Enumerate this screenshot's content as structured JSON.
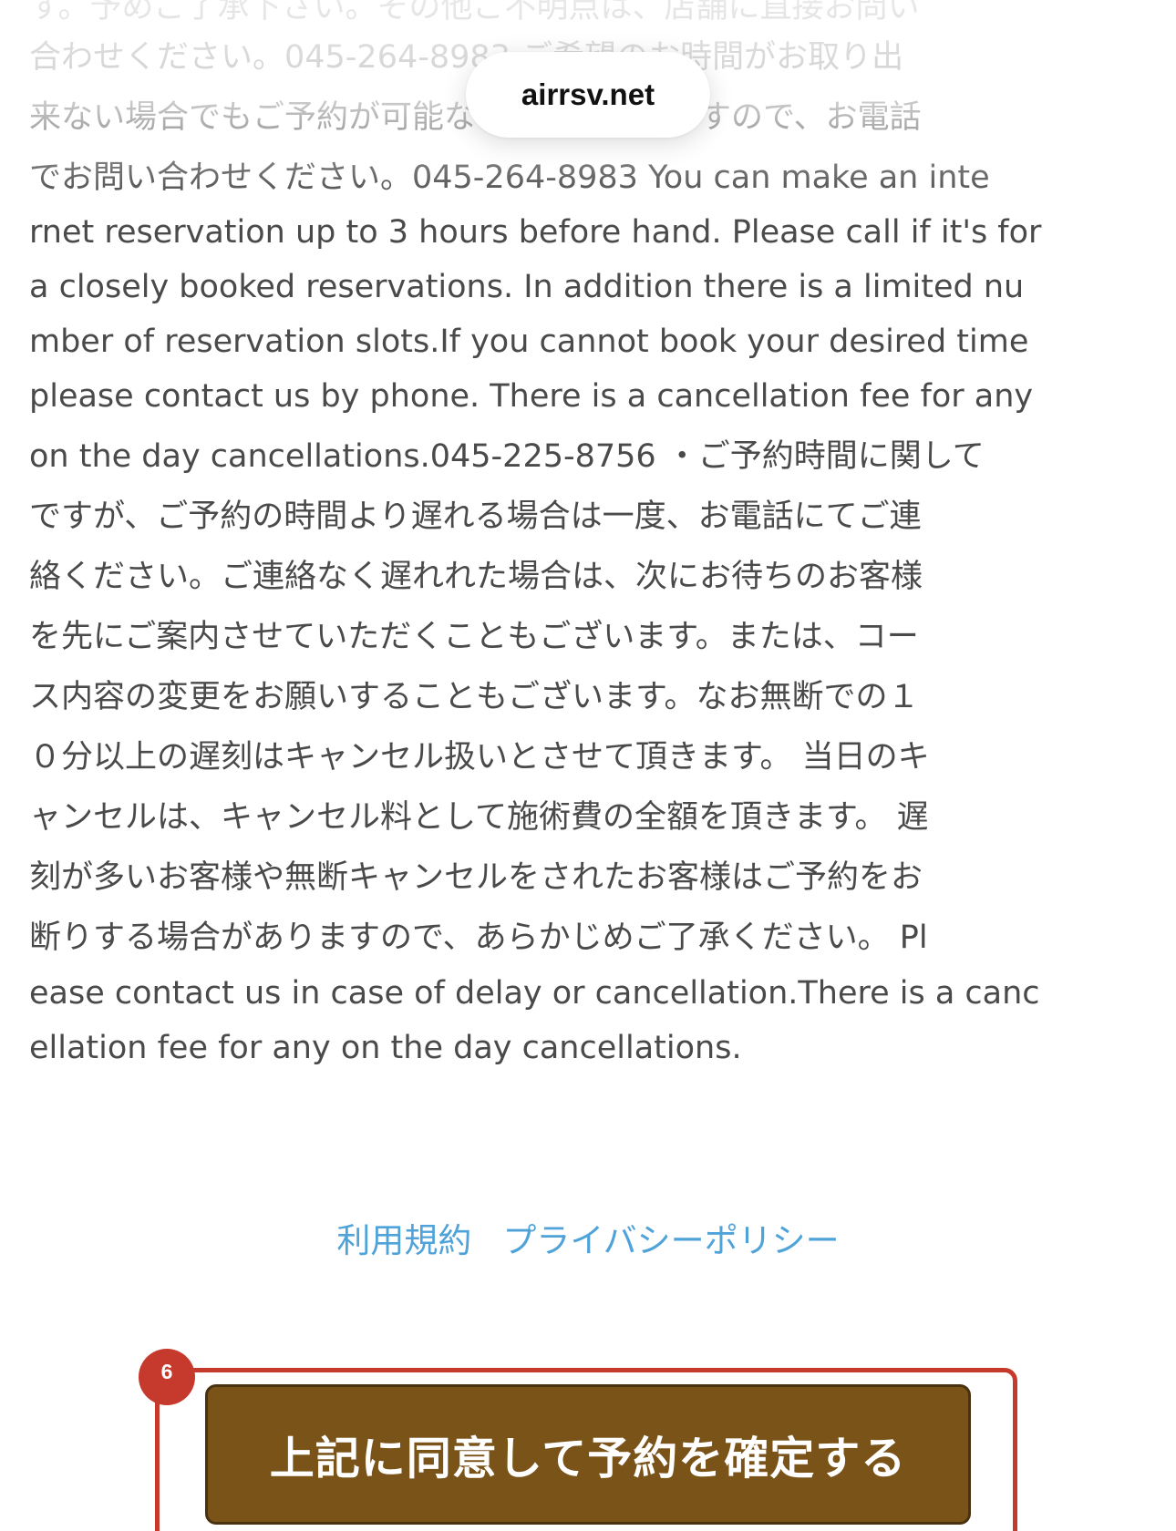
{
  "browser": {
    "url": "airrsv.net"
  },
  "policy": {
    "lines": [
      "す。予めご了承下さい。その他ご不明点は、店舗に直接お問い",
      "合わせください。045-264-8983 ご希望のお時間がお取り出",
      "来ない場合でもご予約が可能な場合がございますので、お電話",
      "でお問い合わせください。045-264-8983 You can make an inte",
      "rnet reservation up to 3 hours before hand. Please call if it's for",
      "a closely booked reservations. In addition there is a limited nu",
      "mber of reservation slots.If you cannot book your desired time",
      "please contact us by phone. There is a cancellation fee for any",
      "on the day cancellations.045-225-8756 ・ご予約時間に関して",
      "ですが、ご予約の時間より遅れる場合は一度、お電話にてご連",
      "絡ください。ご連絡なく遅れれた場合は、次にお待ちのお客様",
      "を先にご案内させていただくこともございます。または、コー",
      "ス内容の変更をお願いすることもございます。なお無断での１",
      "０分以上の遅刻はキャンセル扱いとさせて頂きます。 当日のキ",
      "ャンセルは、キャンセル料として施術費の全額を頂きます。 遅",
      "刻が多いお客様や無断キャンセルをされたお客様はご予約をお",
      "断りする場合がありますので、あらかじめご了承ください。 Pl",
      "ease contact us in case of delay or cancellation.There is a canc",
      "ellation fee for any on the day cancellations."
    ]
  },
  "footer": {
    "terms_label": "利用規約",
    "privacy_label": "プライバシーポリシー"
  },
  "action": {
    "step_number": "6",
    "confirm_label": "上記に同意して予約を確定する"
  },
  "colors": {
    "link": "#4fa3d9",
    "button_bg": "#7a5319",
    "highlight": "#c53a2c"
  }
}
